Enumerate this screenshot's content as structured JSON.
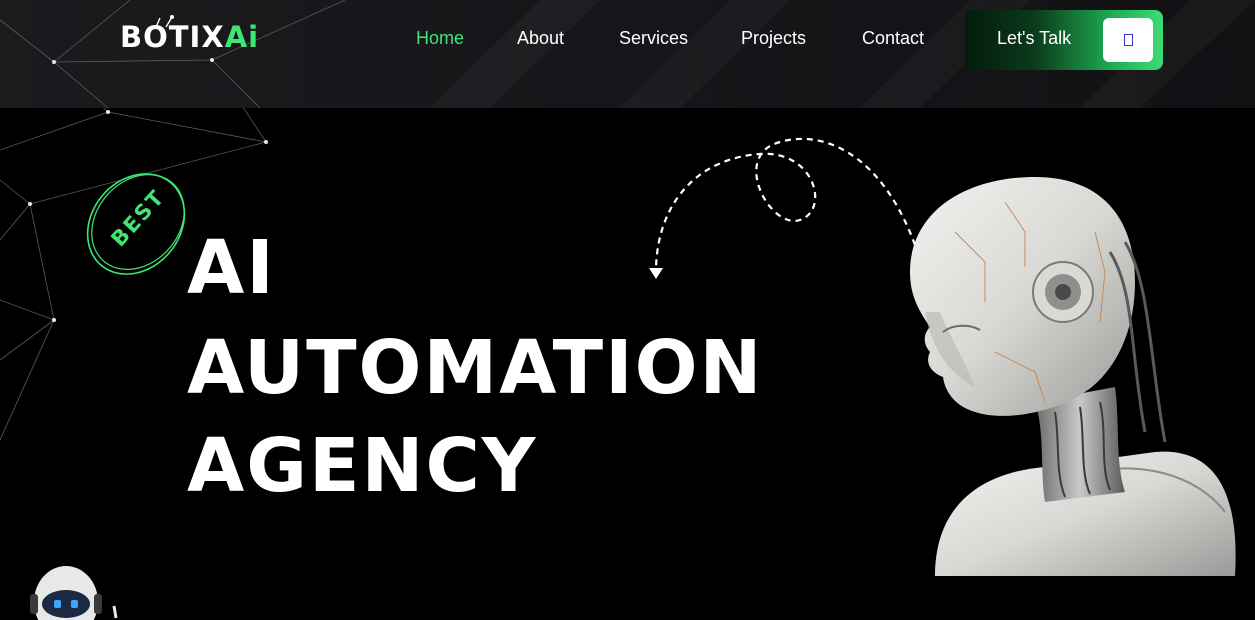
{
  "brand": {
    "logo_main": "BOTIX",
    "logo_accent": "Ai",
    "accent_color": "#3ee673"
  },
  "nav": {
    "items": [
      {
        "label": "Home",
        "active": true
      },
      {
        "label": "About",
        "active": false
      },
      {
        "label": "Services",
        "active": false
      },
      {
        "label": "Projects",
        "active": false
      },
      {
        "label": "Contact",
        "active": false
      }
    ]
  },
  "cta": {
    "label": "Let's Talk",
    "icon": "arrow-icon"
  },
  "hero": {
    "badge": "BEST",
    "title_lines": [
      "AI",
      "AUTOMATION",
      "AGENCY"
    ]
  },
  "images": {
    "hero_robot": "robot-head-illustration",
    "mini_bot": "mini-robot-mascot"
  }
}
